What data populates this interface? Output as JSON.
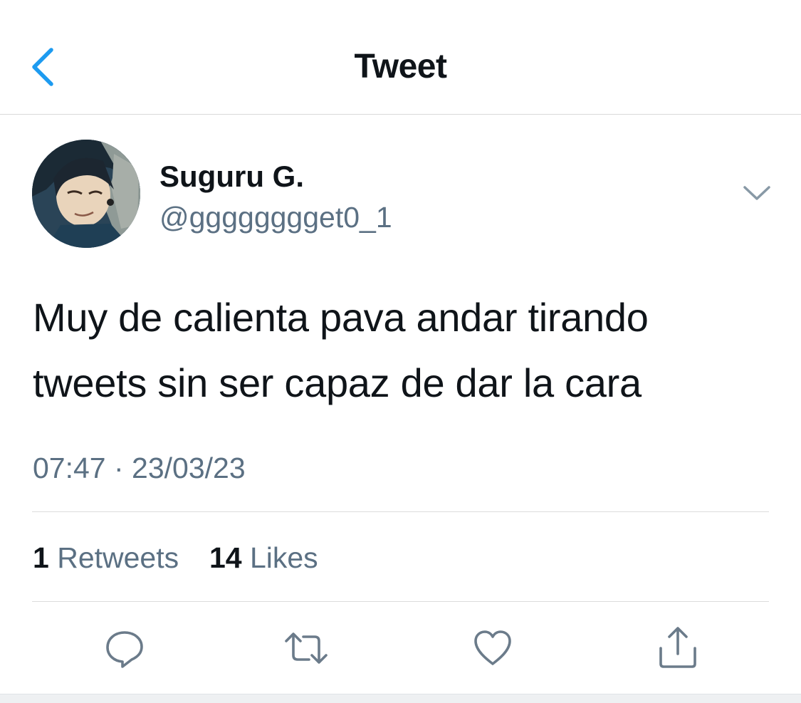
{
  "header": {
    "title": "Tweet",
    "back_icon": "chevron-left-icon",
    "accent_color": "#1d9bf0"
  },
  "author": {
    "display_name": "Suguru G.",
    "handle": "@gggggggget0_1",
    "menu_icon": "chevron-down-icon"
  },
  "tweet": {
    "text_line_1": "Muy de calienta pava andar tirando",
    "text_line_2": "tweets sin ser capaz de dar la cara",
    "timestamp": "07:47 · 23/03/23"
  },
  "stats": {
    "retweets_count": "1",
    "retweets_label": "Retweets",
    "likes_count": "14",
    "likes_label": "Likes"
  },
  "actions": [
    "reply-icon",
    "retweet-icon",
    "like-icon",
    "share-icon"
  ],
  "colors": {
    "text_primary": "#0f1419",
    "text_secondary": "#5b7083",
    "icon_gray": "#6b7b8a"
  }
}
